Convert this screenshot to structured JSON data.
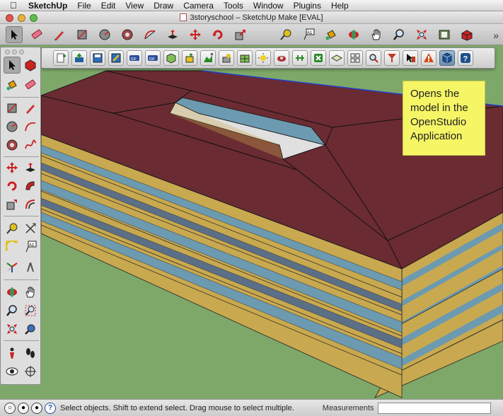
{
  "menubar": {
    "app": "SketchUp",
    "items": [
      "File",
      "Edit",
      "View",
      "Draw",
      "Camera",
      "Tools",
      "Window",
      "Plugins",
      "Help"
    ]
  },
  "window": {
    "title": "3storyschool – SketchUp Make [EVAL]",
    "light_colors": [
      "#e5534b",
      "#e9b23b",
      "#5cbf4a"
    ]
  },
  "main_toolbar": {
    "tools": [
      "select-icon",
      "eraser-icon",
      "pencil-icon",
      "rectangle-icon",
      "circle-icon",
      "polygon-icon",
      "arc-icon",
      "push-pull-icon",
      "move-icon",
      "rotate-icon",
      "scale-icon",
      "tape-measure-icon",
      "text-icon",
      "paint-bucket-icon",
      "orbit-icon",
      "pan-icon",
      "zoom-icon",
      "zoom-extents-icon",
      "components-icon",
      "warehouse-icon"
    ],
    "overflow": "»"
  },
  "plugin_toolbar": {
    "buttons": [
      "new-openstudio-model-icon",
      "open-openstudio-model-icon",
      "save-openstudio-model-icon",
      "save-as-icon",
      "import-idf-icon",
      "export-idf-icon",
      "space-icon",
      "thermal-zone-icon",
      "building-story-icon",
      "shading-group-icon",
      "interior-partition-icon",
      "illuminance-map-icon",
      "luminaire-icon",
      "daylighting-icon",
      "surface-matching-icon",
      "new-surface-icon",
      "render-mode-icon",
      "search-surfaces-icon",
      "filter-icon",
      "info-tool-icon",
      "errors-warnings-icon",
      "openstudio-application-icon",
      "help-icon"
    ]
  },
  "palette": {
    "tools": [
      "select-icon",
      "paint-bucket-icon",
      "make-component-icon",
      "eraser-icon",
      "rectangle-icon",
      "pencil-icon",
      "circle-icon",
      "arc-icon",
      "polygon-icon",
      "freehand-icon",
      "move-icon",
      "push-pull-icon",
      "rotate-icon",
      "follow-me-icon",
      "scale-icon",
      "offset-icon",
      "tape-measure-icon",
      "dimension-icon",
      "protractor-icon",
      "text-icon",
      "axes-icon",
      "3d-text-icon",
      "orbit-icon",
      "pan-icon",
      "zoom-icon",
      "zoom-window-icon",
      "zoom-extents-icon",
      "previous-view-icon",
      "position-camera-icon",
      "walk-icon",
      "look-around-icon",
      "section-plane-icon"
    ]
  },
  "callout": {
    "lines": [
      "Opens the",
      "model in the",
      "OpenStudio",
      "Application"
    ]
  },
  "statusbar": {
    "status_text": "Select objects. Shift to extend select. Drag mouse to select multiple.",
    "measurements_label": "Measurements",
    "measurements_value": ""
  },
  "colors": {
    "ground": "#7da86a",
    "roof": "#6b2b32",
    "wall": "#c9a94f",
    "glass": "#6c9ab0",
    "callout": "#f5f566"
  }
}
